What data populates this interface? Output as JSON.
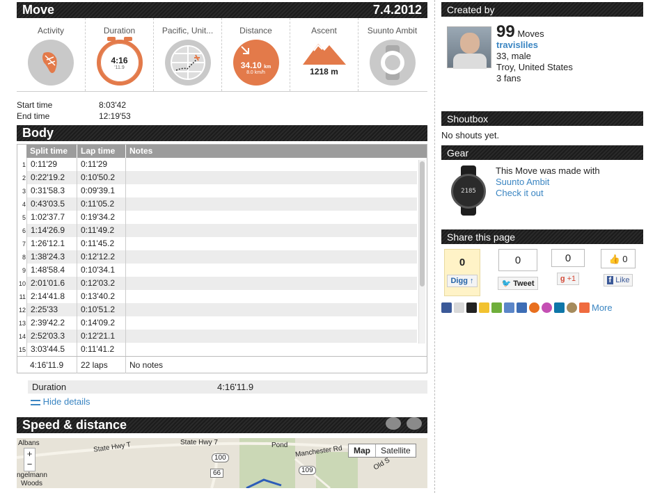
{
  "move": {
    "title": "Move",
    "date": "7.4.2012",
    "metrics": [
      {
        "label": "Activity"
      },
      {
        "label": "Duration",
        "value": "4:16",
        "sub": "'11.9"
      },
      {
        "label": "Pacific, Unit..."
      },
      {
        "label": "Distance",
        "value": "34.10",
        "unit": "km",
        "sub": "8.0 km/h"
      },
      {
        "label": "Ascent",
        "value": "1218 m"
      },
      {
        "label": "Suunto Ambit"
      }
    ],
    "start_label": "Start time",
    "start_value": "8:03'42",
    "end_label": "End time",
    "end_value": "12:19'53"
  },
  "body": {
    "title": "Body",
    "columns": [
      "Split time",
      "Lap time",
      "Notes"
    ],
    "rows": [
      [
        "1",
        "0:11'29",
        "0:11'29"
      ],
      [
        "2",
        "0:22'19.2",
        "0:10'50.2"
      ],
      [
        "3",
        "0:31'58.3",
        "0:09'39.1"
      ],
      [
        "4",
        "0:43'03.5",
        "0:11'05.2"
      ],
      [
        "5",
        "1:02'37.7",
        "0:19'34.2"
      ],
      [
        "6",
        "1:14'26.9",
        "0:11'49.2"
      ],
      [
        "7",
        "1:26'12.1",
        "0:11'45.2"
      ],
      [
        "8",
        "1:38'24.3",
        "0:12'12.2"
      ],
      [
        "9",
        "1:48'58.4",
        "0:10'34.1"
      ],
      [
        "10",
        "2:01'01.6",
        "0:12'03.2"
      ],
      [
        "11",
        "2:14'41.8",
        "0:13'40.2"
      ],
      [
        "12",
        "2:25'33",
        "0:10'51.2"
      ],
      [
        "13",
        "2:39'42.2",
        "0:14'09.2"
      ],
      [
        "14",
        "2:52'03.3",
        "0:12'21.1"
      ],
      [
        "15",
        "3:03'44.5",
        "0:11'41.2"
      ]
    ],
    "total_split": "4:16'11.9",
    "total_laps": "22 laps",
    "total_notes": "No notes",
    "duration_label": "Duration",
    "duration_value": "4:16'11.9",
    "hide_details": "Hide details"
  },
  "speed": {
    "title": "Speed & distance",
    "map_btn": "Map",
    "satellite_btn": "Satellite",
    "labels": [
      "Albans",
      "State Hwy T",
      "State Hwy 7",
      "Pond",
      "Manchester Rd",
      "Old S",
      "100",
      "66",
      "109",
      "ngelmann",
      "Woods"
    ]
  },
  "created": {
    "title": "Created by",
    "moves_count": "99",
    "moves_label": "Moves",
    "username": "travisliles",
    "age_gender": "33, male",
    "location": "Troy, United States",
    "fans": "3 fans"
  },
  "shoutbox": {
    "title": "Shoutbox",
    "text": "No shouts yet."
  },
  "gear": {
    "title": "Gear",
    "made_with": "This Move was made with",
    "device": "Suunto Ambit",
    "check": "Check it out",
    "watch_text": "2185"
  },
  "share": {
    "title": "Share this page",
    "digg_count": "0",
    "digg_label": "Digg",
    "tweet_count": "0",
    "tweet_label": "Tweet",
    "gplus_count": "0",
    "gplus_label": "+1",
    "like_count": "0",
    "like_label": "Like",
    "more_label": "More"
  },
  "colors": {
    "accent": "#e37a4a",
    "link": "#3a85c2",
    "header": "#1f1f1f"
  }
}
